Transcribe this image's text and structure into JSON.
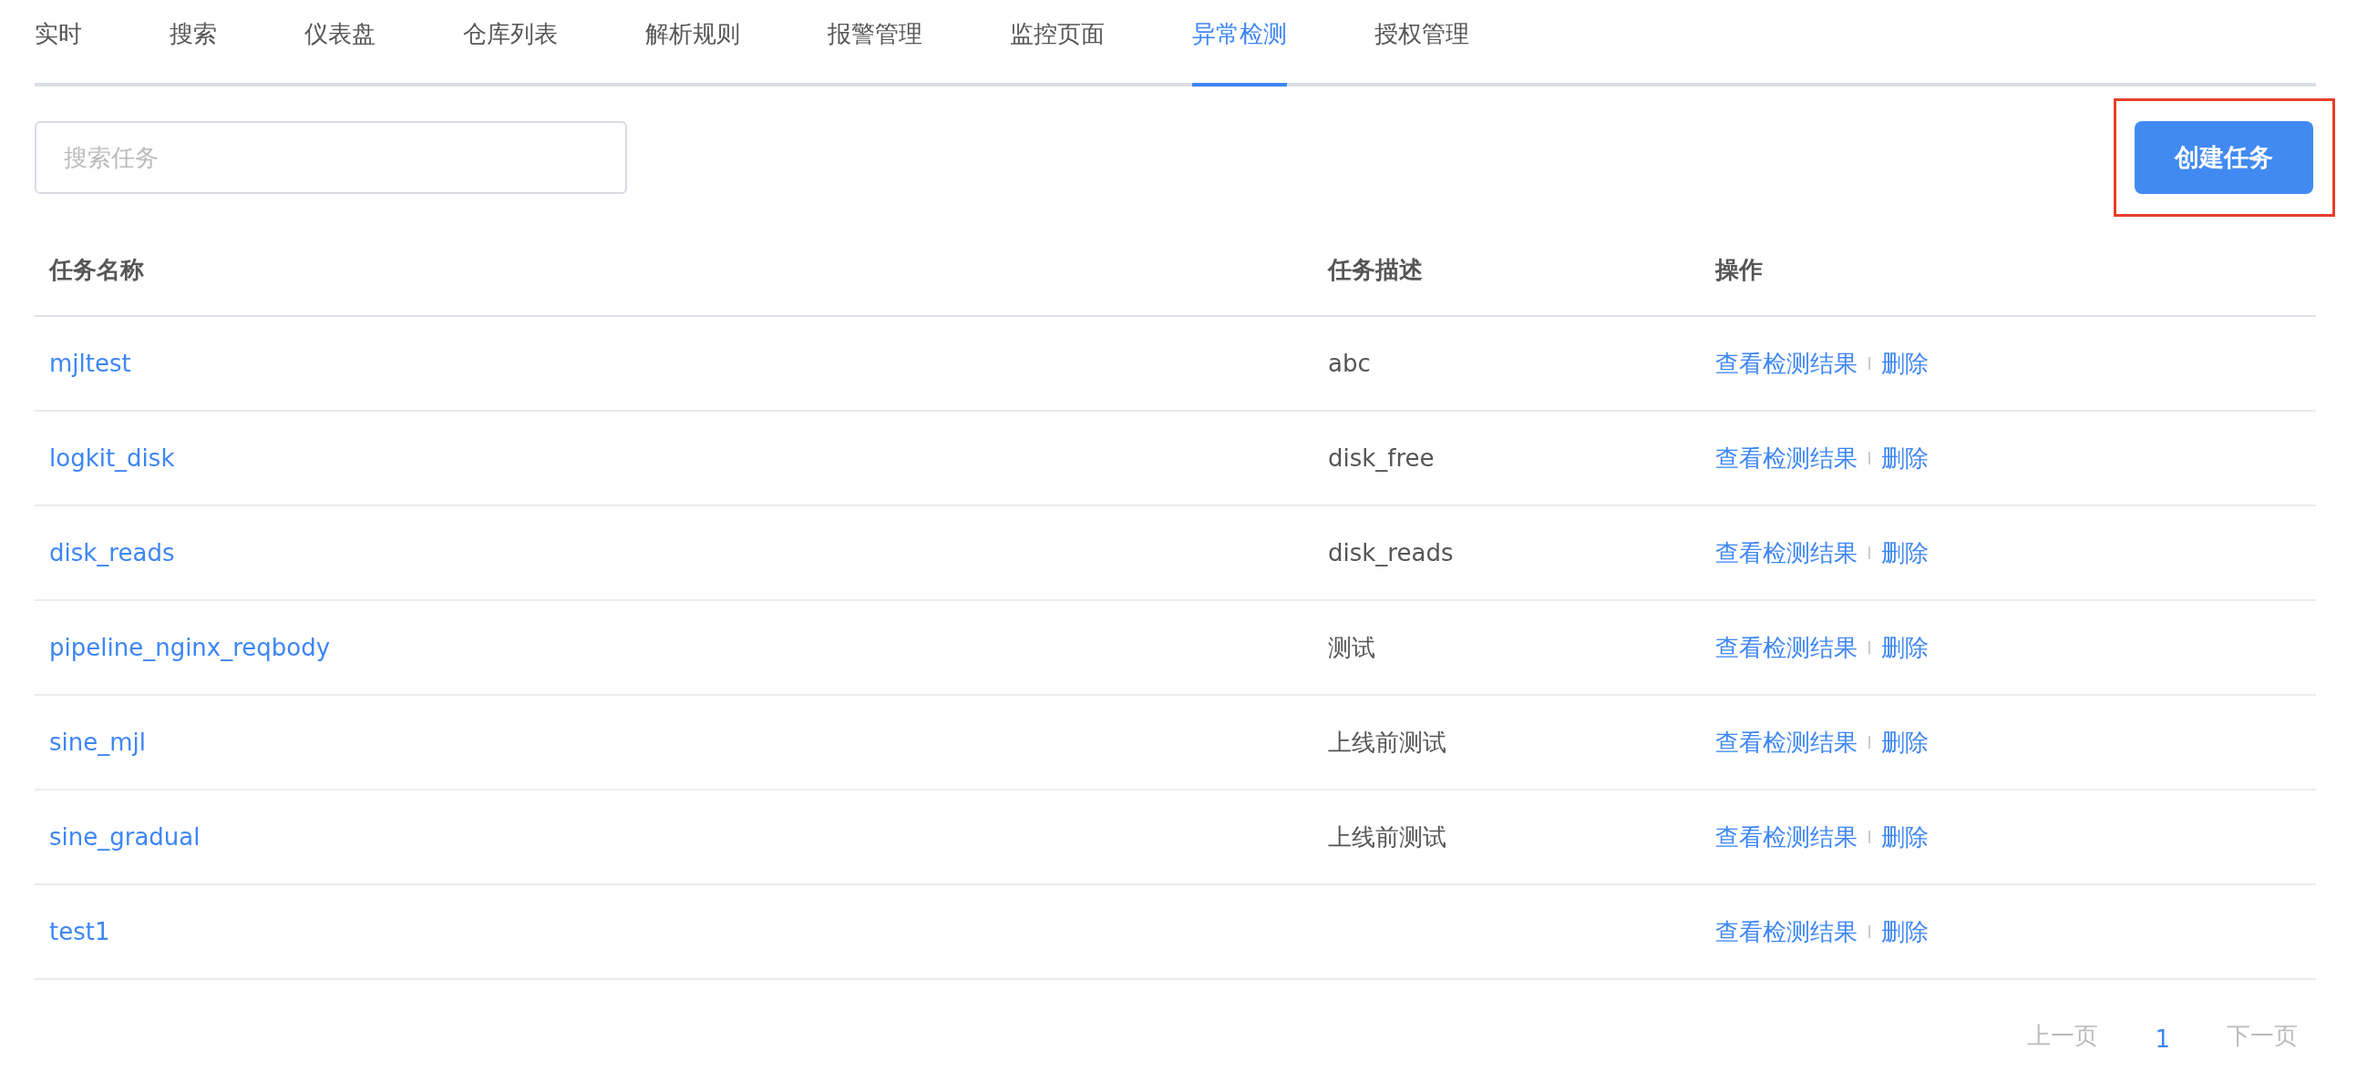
{
  "tabs": [
    {
      "label": "实时",
      "selected": false
    },
    {
      "label": "搜索",
      "selected": false
    },
    {
      "label": "仪表盘",
      "selected": false
    },
    {
      "label": "仓库列表",
      "selected": false
    },
    {
      "label": "解析规则",
      "selected": false
    },
    {
      "label": "报警管理",
      "selected": false
    },
    {
      "label": "监控页面",
      "selected": false
    },
    {
      "label": "异常检测",
      "selected": true
    },
    {
      "label": "授权管理",
      "selected": false
    }
  ],
  "search": {
    "placeholder": "搜索任务"
  },
  "create_button": {
    "label": "创建任务",
    "highlighted": true
  },
  "table": {
    "columns": [
      "任务名称",
      "任务描述",
      "操作"
    ],
    "rows": [
      {
        "name": "mjltest",
        "description": "abc",
        "actions": [
          "查看检测结果",
          "删除"
        ]
      },
      {
        "name": "logkit_disk",
        "description": "disk_free",
        "actions": [
          "查看检测结果",
          "删除"
        ]
      },
      {
        "name": "disk_reads",
        "description": "disk_reads",
        "actions": [
          "查看检测结果",
          "删除"
        ]
      },
      {
        "name": "pipeline_nginx_reqbody",
        "description": "测试",
        "actions": [
          "查看检测结果",
          "删除"
        ]
      },
      {
        "name": "sine_mjl",
        "description": "上线前测试",
        "actions": [
          "查看检测结果",
          "删除"
        ]
      },
      {
        "name": "sine_gradual",
        "description": "上线前测试",
        "actions": [
          "查看检测结果",
          "删除"
        ]
      },
      {
        "name": "test1",
        "actions": [
          "查看检测结果",
          "删除"
        ]
      }
    ]
  },
  "pagination": {
    "prev": {
      "label": "上一页",
      "disabled": true
    },
    "pages": [
      {
        "label": "1",
        "selected": true
      }
    ],
    "next": {
      "label": "下一页",
      "disabled": true
    }
  }
}
